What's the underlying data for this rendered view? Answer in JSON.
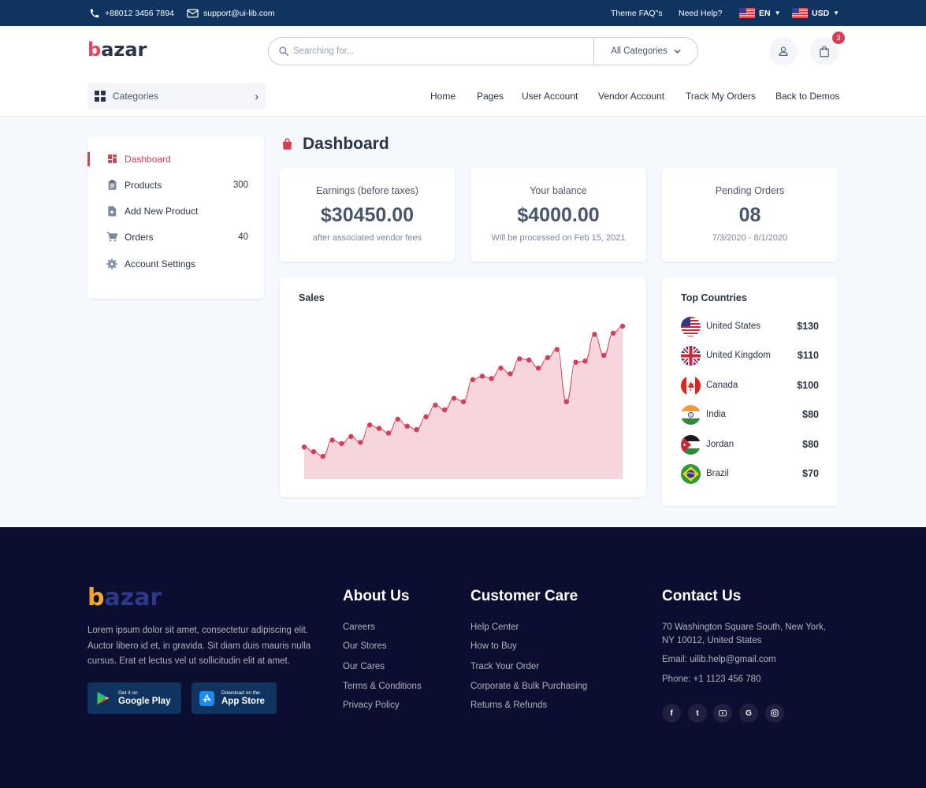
{
  "topbar": {
    "phone": "+88012 3456 7894",
    "email": "support@ui-lib.com",
    "faq": "Theme FAQ\"s",
    "help": "Need Help?",
    "language": "EN",
    "currency": "USD"
  },
  "header": {
    "logo_b": "b",
    "logo_rest": "azar",
    "search_placeholder": "Searching for...",
    "category_select": "All Categories",
    "cart_count": "3",
    "categories_button": "Categories",
    "nav": [
      "Home",
      "Pages",
      "User Account",
      "Vendor Account",
      "Track My Orders",
      "Back to Demos"
    ]
  },
  "sidebar": {
    "items": [
      {
        "label": "Dashboard",
        "count": "",
        "icon": "dashboard-icon",
        "active": true
      },
      {
        "label": "Products",
        "count": "300",
        "icon": "clipboard-icon"
      },
      {
        "label": "Add New Product",
        "count": "",
        "icon": "add-file-icon"
      },
      {
        "label": "Orders",
        "count": "40",
        "icon": "cart-icon"
      },
      {
        "label": "Account Settings",
        "count": "",
        "icon": "gear-icon"
      }
    ]
  },
  "main": {
    "title": "Dashboard",
    "stats": [
      {
        "title": "Earnings (before taxes)",
        "value": "$30450.00",
        "sub": "after associated vendor fees"
      },
      {
        "title": "Your balance",
        "value": "$4000.00",
        "sub": "Will be processed on Feb 15, 2021"
      },
      {
        "title": "Pending Orders",
        "value": "08",
        "sub": "7/3/2020 - 8/1/2020"
      }
    ],
    "sales_title": "Sales",
    "countries_title": "Top Countries",
    "countries": [
      {
        "name": "United States",
        "amount": "$130",
        "flag": "us-flag-icon"
      },
      {
        "name": "United Kingdom",
        "amount": "$110",
        "flag": "uk-flag-icon"
      },
      {
        "name": "Canada",
        "amount": "$100",
        "flag": "canada-flag-icon"
      },
      {
        "name": "India",
        "amount": "$80",
        "flag": "india-flag-icon"
      },
      {
        "name": "Jordan",
        "amount": "$80",
        "flag": "jordan-flag-icon"
      },
      {
        "name": "Brazil",
        "amount": "$70",
        "flag": "brazil-flag-icon"
      }
    ]
  },
  "chart_data": {
    "type": "area",
    "title": "Sales",
    "xlabel": "",
    "ylabel": "",
    "grid": false,
    "color": "#d23f57",
    "fill": "#f6d6dc",
    "ylim": [
      0,
      100
    ],
    "values": [
      12,
      8,
      4,
      18,
      15,
      21,
      16,
      31,
      28,
      24,
      36,
      30,
      27,
      38,
      48,
      44,
      54,
      51,
      70,
      73,
      71,
      80,
      75,
      88,
      87,
      80,
      89,
      96,
      51,
      85,
      86,
      109,
      91,
      110,
      116
    ]
  },
  "footer": {
    "logo_b": "b",
    "logo_rest": "azar",
    "description": "Lorem ipsum dolor sit amet, consectetur adipiscing elit. Auctor libero id et, in gravida. Sit diam duis mauris nulla cursus. Erat et lectus vel ut sollicitudin elit at amet.",
    "google_small": "Get it on",
    "google_big": "Google Play",
    "apple_small": "Download on the",
    "apple_big": "App Store",
    "about_title": "About Us",
    "about_links": [
      "Careers",
      "Our Stores",
      "Our Cares",
      "Terms & Conditions",
      "Privacy Policy"
    ],
    "care_title": "Customer Care",
    "care_links": [
      "Help Center",
      "How to Buy",
      "Track Your Order",
      "Corporate & Bulk Purchasing",
      "Returns & Refunds"
    ],
    "contact_title": "Contact Us",
    "address_line1": "70 Washington Square South, New York,",
    "address_line2": "NY 10012, United States",
    "email": "Email: uilib.help@gmail.com",
    "phone": "Phone: +1 1123 456 780",
    "social": [
      "facebook-icon",
      "twitter-icon",
      "youtube-icon",
      "google-icon",
      "instagram-icon"
    ]
  }
}
